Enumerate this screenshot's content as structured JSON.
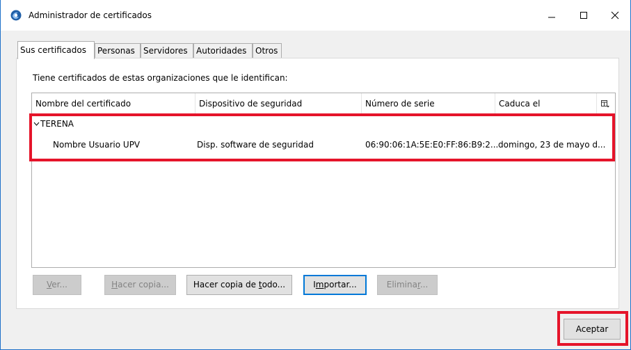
{
  "window": {
    "title": "Administrador de certificados",
    "icon": "thunderbird-icon"
  },
  "tabs": [
    {
      "label": "Sus certificados",
      "active": true
    },
    {
      "label": "Personas",
      "active": false
    },
    {
      "label": "Servidores",
      "active": false
    },
    {
      "label": "Autoridades",
      "active": false
    },
    {
      "label": "Otros",
      "active": false
    }
  ],
  "panel": {
    "intro": "Tiene certificados de estas organizaciones que le identifican:"
  },
  "table": {
    "columns": [
      "Nombre del certificado",
      "Dispositivo de seguridad",
      "Número de serie",
      "Caduca el"
    ],
    "groups": [
      {
        "name": "TERENA",
        "expanded": true,
        "rows": [
          {
            "name": "Nombre Usuario UPV",
            "device": "Disp. software de seguridad",
            "serial": "06:90:06:1A:5E:E0:FF:86:B9:2...",
            "expires": "domingo, 23 de mayo d..."
          }
        ]
      }
    ]
  },
  "buttons": {
    "view": {
      "pre": "",
      "mn": "V",
      "post": "er..."
    },
    "backup": {
      "pre": "",
      "mn": "H",
      "post": "acer copia..."
    },
    "backup_all": {
      "pre": "Hacer copia de ",
      "mn": "t",
      "post": "odo..."
    },
    "import": {
      "pre": "I",
      "mn": "m",
      "post": "portar..."
    },
    "delete": {
      "pre": "Elimina",
      "mn": "r",
      "post": "..."
    },
    "ok": "Aceptar"
  },
  "colors": {
    "highlight": "#e5142a",
    "focus": "#0078d7",
    "window_border": "#1e70c9"
  }
}
